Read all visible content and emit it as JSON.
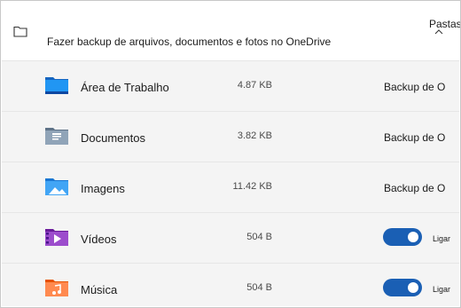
{
  "header": {
    "title": "Fazer backup de arquivos, documentos e fotos no OneDrive",
    "right_label": "Pastas",
    "folder_icon": "folder-outline-icon",
    "chevron_icon": "chevron-up-icon"
  },
  "rows": [
    {
      "name": "Área de Trabalho",
      "size": "4.87 KB",
      "status": "Backup de O",
      "icon": "desktop-folder-icon",
      "color": "#1f8ee0"
    },
    {
      "name": "Documentos",
      "size": "3.82 KB",
      "status": "Backup de O",
      "icon": "documents-folder-icon",
      "color": "#7d8fa6"
    },
    {
      "name": "Imagens",
      "size": "11.42 KB",
      "status": "Backup de O",
      "icon": "pictures-folder-icon",
      "color": "#2a9bea"
    },
    {
      "name": "Vídeos",
      "size": "504 B",
      "toggle_label": "Ligar",
      "toggle_on": true,
      "icon": "videos-folder-icon",
      "color": "#8a43d6"
    },
    {
      "name": "Música",
      "size": "504 B",
      "toggle_label": "Ligar",
      "toggle_on": true,
      "icon": "music-folder-icon",
      "color": "#e0713a"
    }
  ],
  "colors": {
    "toggle_on": "#1a5fb4",
    "list_background": "#f4f4f4"
  }
}
